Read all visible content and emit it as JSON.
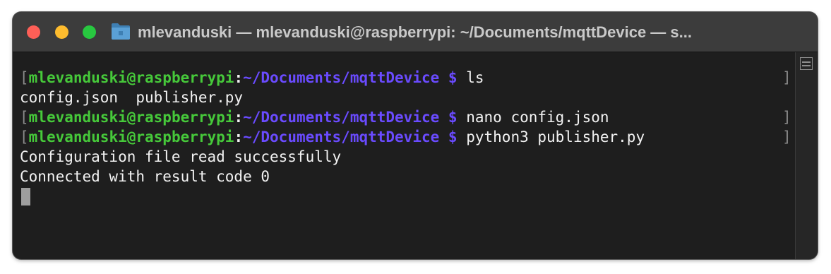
{
  "window": {
    "title": "mlevanduski — mlevanduski@raspberrypi: ~/Documents/mqttDevice — s..."
  },
  "terminal": {
    "prompt_user": "mlevanduski@raspberrypi",
    "prompt_colon": ":",
    "prompt_path": "~/Documents/mqttDevice",
    "prompt_symbol": "$",
    "bracket_open": "[",
    "bracket_close": "]",
    "commands": [
      "ls",
      "nano config.json",
      "python3 publisher.py"
    ],
    "outputs": [
      "config.json  publisher.py",
      "Configuration file read successfully",
      "Connected with result code 0"
    ]
  },
  "colors": {
    "user": "#46c93a",
    "path": "#6a4bff",
    "background": "#1e1e1e",
    "titlebar": "#3c3c3c"
  },
  "icons": {
    "titlebar_folder": "folder-icon",
    "scrollbar": "scroll-marker-icon"
  }
}
